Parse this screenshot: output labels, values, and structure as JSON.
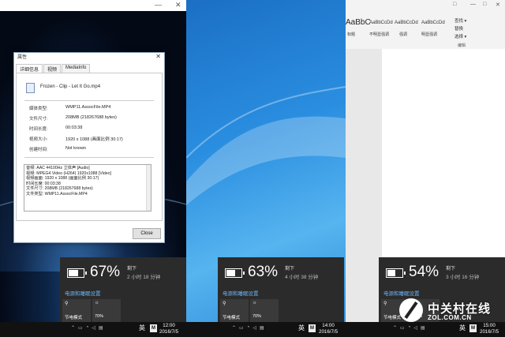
{
  "window": {
    "title": "属性",
    "close_glyph": "✕",
    "file_name": "Frozen - Clip - Let It Go.mp4"
  },
  "tabs": [
    "详细信息",
    "视频",
    "MediaInfo"
  ],
  "properties": [
    {
      "label": "媒体类型:",
      "value": "WMP11.AssocFile.MP4"
    },
    {
      "label": "文件尺寸:",
      "value": "208MB (218267688 bytes)"
    },
    {
      "label": "时间长度:",
      "value": "00:03:38"
    },
    {
      "label": "视频大小:",
      "value": "1920 x 1088 (画面比例 30:17)"
    },
    {
      "label": "创建时间:",
      "value": "Not known"
    }
  ],
  "mediainfo_lines": [
    "音频: AAC 44100Hz 立体声 [Audio]",
    "视频: MPEG4 Video (H264) 1920x1088 [Video]",
    "视频画面: 1920 x 1088 (画面比例 30:17)",
    "时间长度: 00:03:38",
    "文件尺寸: 208MB (218267688 bytes)",
    "文件类型: WMP11.AssocFile.MP4"
  ],
  "close_label": "Close",
  "flyouts": [
    {
      "percent": "67%",
      "percent_value": 67,
      "remain_label": "剩下",
      "remain_time": "2 小时 18 分钟"
    },
    {
      "percent": "63%",
      "percent_value": 63,
      "remain_label": "剩下",
      "remain_time": "4 小时 38 分钟"
    },
    {
      "percent": "54%",
      "percent_value": 54,
      "remain_label": "剩下",
      "remain_time": "3 小时 16 分钟"
    }
  ],
  "flyout_common": {
    "settings_link": "电源和睡眠设置",
    "tile1_label": "节电模式",
    "tile2_label": "70%"
  },
  "taskbars": [
    {
      "ime": "英",
      "m": "M",
      "time": "12:00",
      "date": "2016/7/5"
    },
    {
      "ime": "英",
      "m": "M",
      "time": "14:00",
      "date": "2016/7/5"
    },
    {
      "ime": "英",
      "m": "M",
      "time": "15:00",
      "date": "2016/7/5"
    }
  ],
  "word": {
    "style_big": "AaBbC",
    "styles": [
      "AaBbCcDd",
      "AaBbCcDd",
      "AaBbCcDd"
    ],
    "style_labels": [
      "标题",
      "不明显强调",
      "强调",
      "明显强调"
    ],
    "edit": [
      "查找 ▾",
      "替换",
      "选择 ▾"
    ],
    "group_label": "编辑"
  },
  "watermark": {
    "brand": "中关村在线",
    "url": "ZOL.COM.CN"
  }
}
